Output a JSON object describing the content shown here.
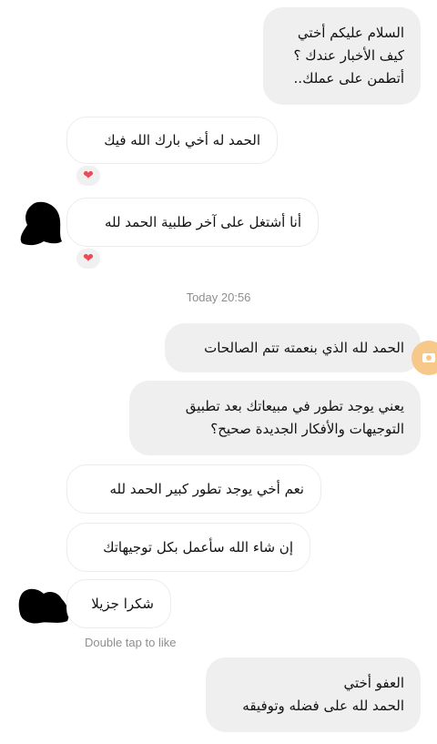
{
  "messages": [
    {
      "lines": [
        "السلام عليكم أختي",
        "كيف الأخبار عندك ؟",
        "أتطمن على عملك.."
      ]
    },
    {
      "lines": [
        "الحمد له أخي بارك الله فيك"
      ]
    },
    {
      "lines": [
        "أنا أشتغل على آخر طلبية الحمد لله"
      ]
    },
    {
      "lines": [
        "الحمد لله الذي بنعمته تتم الصالحات"
      ]
    },
    {
      "lines": [
        "يعني يوجد تطور في مبيعاتك بعد تطبيق",
        "التوجيهات والأفكار الجديدة صحيح؟"
      ]
    },
    {
      "lines": [
        "نعم أخي يوجد تطور كبير الحمد لله"
      ]
    },
    {
      "lines": [
        "إن شاء الله سأعمل بكل توجيهاتك"
      ]
    },
    {
      "lines": [
        "شكرا جزيلا"
      ]
    },
    {
      "lines": [
        "العفو أختي",
        "الحمد لله على فضله وتوفيقه"
      ]
    }
  ],
  "reactions": {
    "emoji": "❤"
  },
  "timestamp": "Today 20:56",
  "hint": "Double tap to like",
  "colors": {
    "outgoing_bubble": "#efefef",
    "incoming_border": "#ececec",
    "heart": "#ed4956",
    "meta_text": "#8e8e8e",
    "edge_button": "#f6c98a"
  }
}
